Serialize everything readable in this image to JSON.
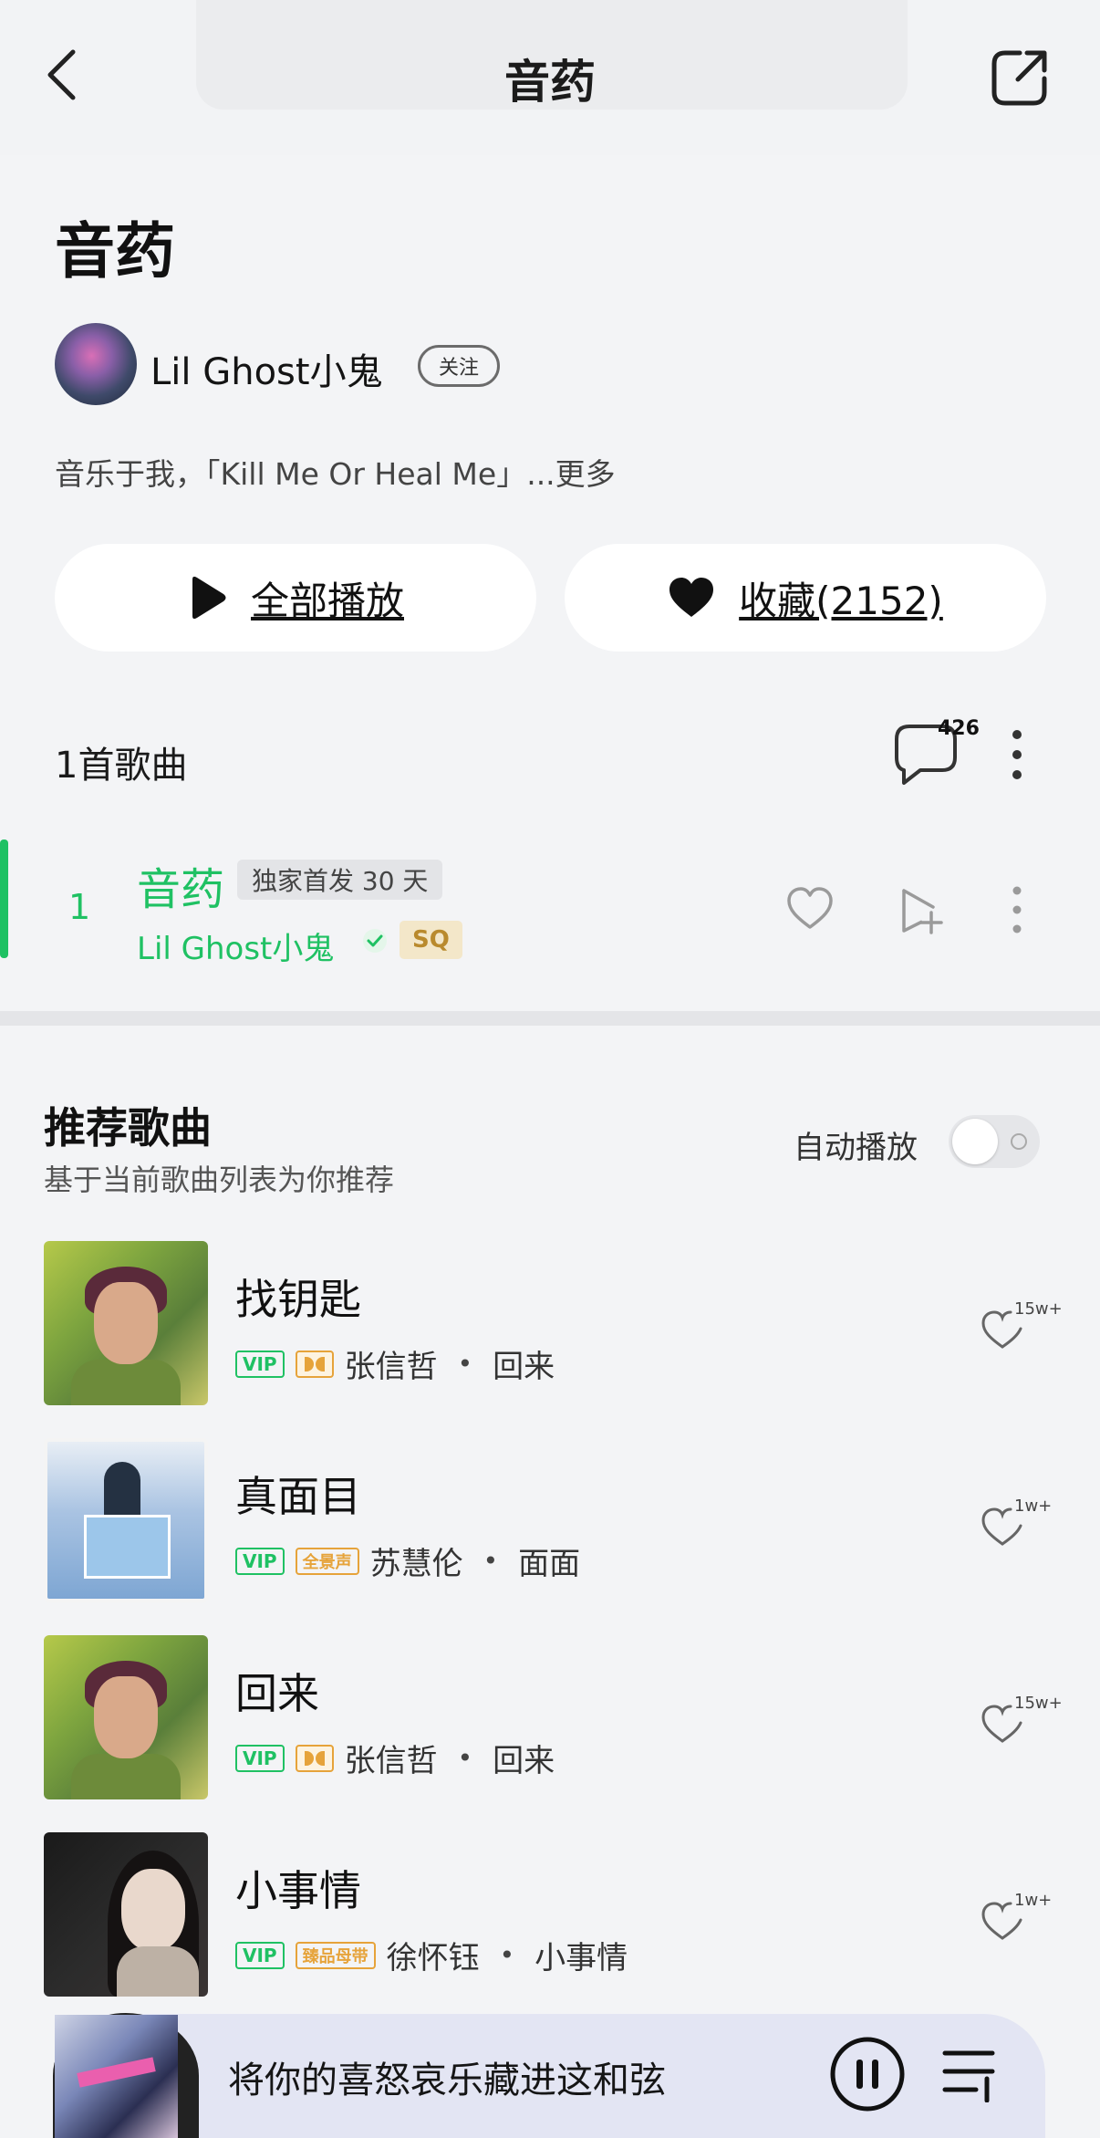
{
  "header": {
    "title": "音药"
  },
  "playlist": {
    "title": "音药",
    "artist": "Lil Ghost小鬼",
    "follow_label": "关注",
    "description": "音乐于我，「Kill Me Or Heal Me」...更多",
    "play_all_label": "全部播放",
    "collect_label": "收藏(2152)",
    "song_count_label": "1首歌曲",
    "comment_count": "426"
  },
  "track": {
    "index": "1",
    "title": "音药",
    "exclusive_tag": "独家首发 30 天",
    "artist": "Lil Ghost小鬼",
    "quality": "SQ"
  },
  "recommend": {
    "title": "推荐歌曲",
    "subtitle": "基于当前歌曲列表为你推荐",
    "autoplay_label": "自动播放",
    "autoplay_on": false,
    "items": [
      {
        "song": "找钥匙",
        "vip": "VIP",
        "artist": "张信哲",
        "sep": "•",
        "album": "回来",
        "likes": "15w+"
      },
      {
        "song": "真面目",
        "vip": "VIP",
        "badge": "全景声",
        "artist": "苏慧伦",
        "sep": "•",
        "album": "面面",
        "likes": "1w+"
      },
      {
        "song": "回来",
        "vip": "VIP",
        "artist": "张信哲",
        "sep": "•",
        "album": "回来",
        "likes": "15w+"
      },
      {
        "song": "小事情",
        "vip": "VIP",
        "badge": "臻品母带",
        "artist": "徐怀钰",
        "sep": "•",
        "album": "小事情",
        "likes": "1w+"
      }
    ]
  },
  "player": {
    "now_playing": "将你的喜怒哀乐藏进这和弦"
  },
  "colors": {
    "accent": "#1fc163",
    "gold": "#e6a33a",
    "background": "#f3f4f6"
  },
  "icons": [
    "back-icon",
    "share-icon",
    "play-icon",
    "heart-icon",
    "comment-icon",
    "more-icon",
    "verified-icon",
    "add-to-playlist-icon",
    "pause-icon",
    "playlist-icon"
  ]
}
